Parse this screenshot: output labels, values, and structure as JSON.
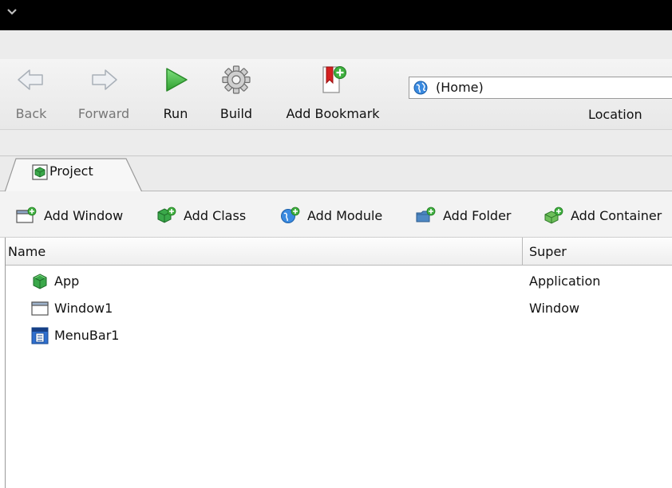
{
  "toolbar": {
    "back_label": "Back",
    "forward_label": "Forward",
    "run_label": "Run",
    "build_label": "Build",
    "add_bookmark_label": "Add Bookmark",
    "location_value": "(Home)",
    "location_label": "Location"
  },
  "tabs": [
    {
      "label": "Project",
      "icon": "project-cube-icon",
      "selected": true
    }
  ],
  "actions": {
    "add_window": "Add Window",
    "add_class": "Add Class",
    "add_module": "Add Module",
    "add_folder": "Add Folder",
    "add_container": "Add Container"
  },
  "table": {
    "columns": [
      "Name",
      "Super"
    ],
    "rows": [
      {
        "name": "App",
        "super": "Application",
        "icon": "app-cube-icon"
      },
      {
        "name": "Window1",
        "super": "Window",
        "icon": "window-icon"
      },
      {
        "name": "MenuBar1",
        "super": "",
        "icon": "menubar-icon"
      }
    ]
  },
  "colors": {
    "titlebar": "#000000",
    "run_green": "#3cb23c",
    "bookmark_red": "#d42020",
    "cube_green": "#3aa84a",
    "globe_blue": "#2f7fd3"
  }
}
